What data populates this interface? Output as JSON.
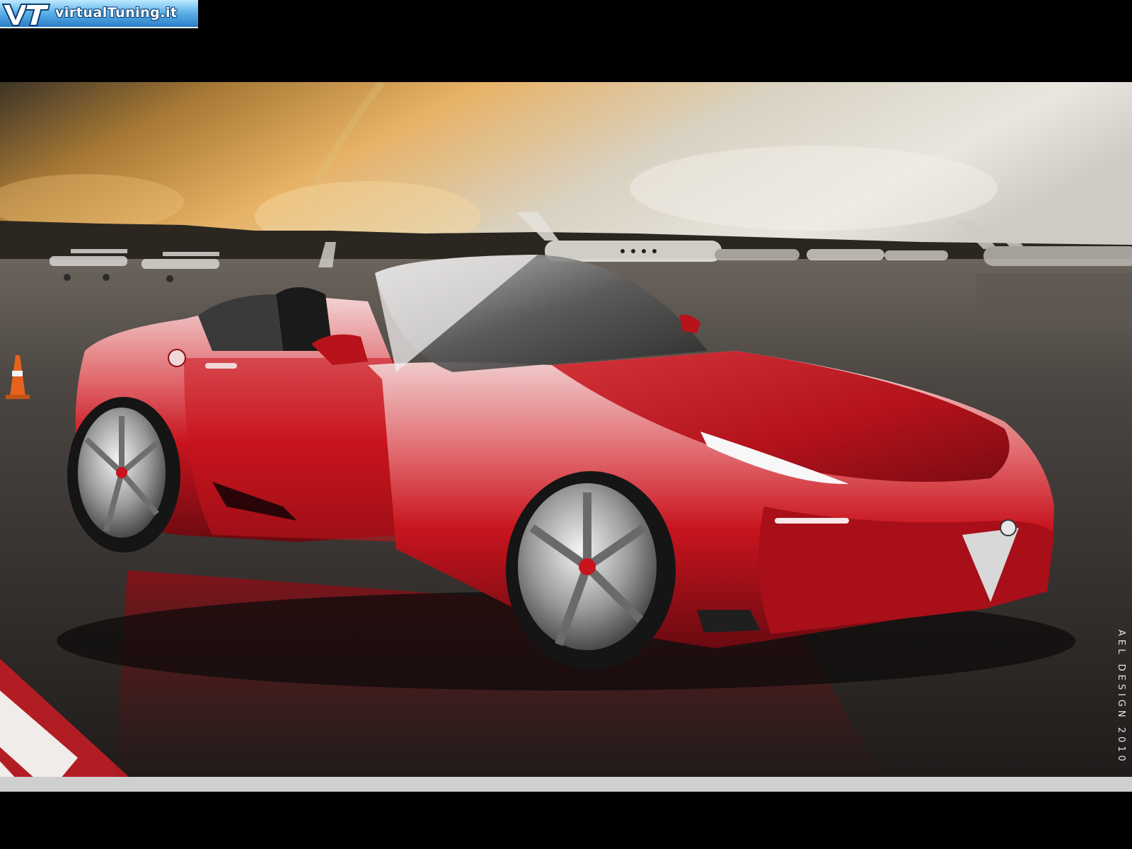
{
  "site_logo": {
    "text": "virtualTuning.it",
    "icon": "vt-logo-icon"
  },
  "photo": {
    "subject": "red-convertible-sports-car",
    "colors": {
      "car_body": "#c8141e",
      "sky_warm": "#e7b266",
      "tarmac": "#3a3533"
    }
  },
  "watermark": {
    "text": "AEL DESIGN 2010"
  }
}
